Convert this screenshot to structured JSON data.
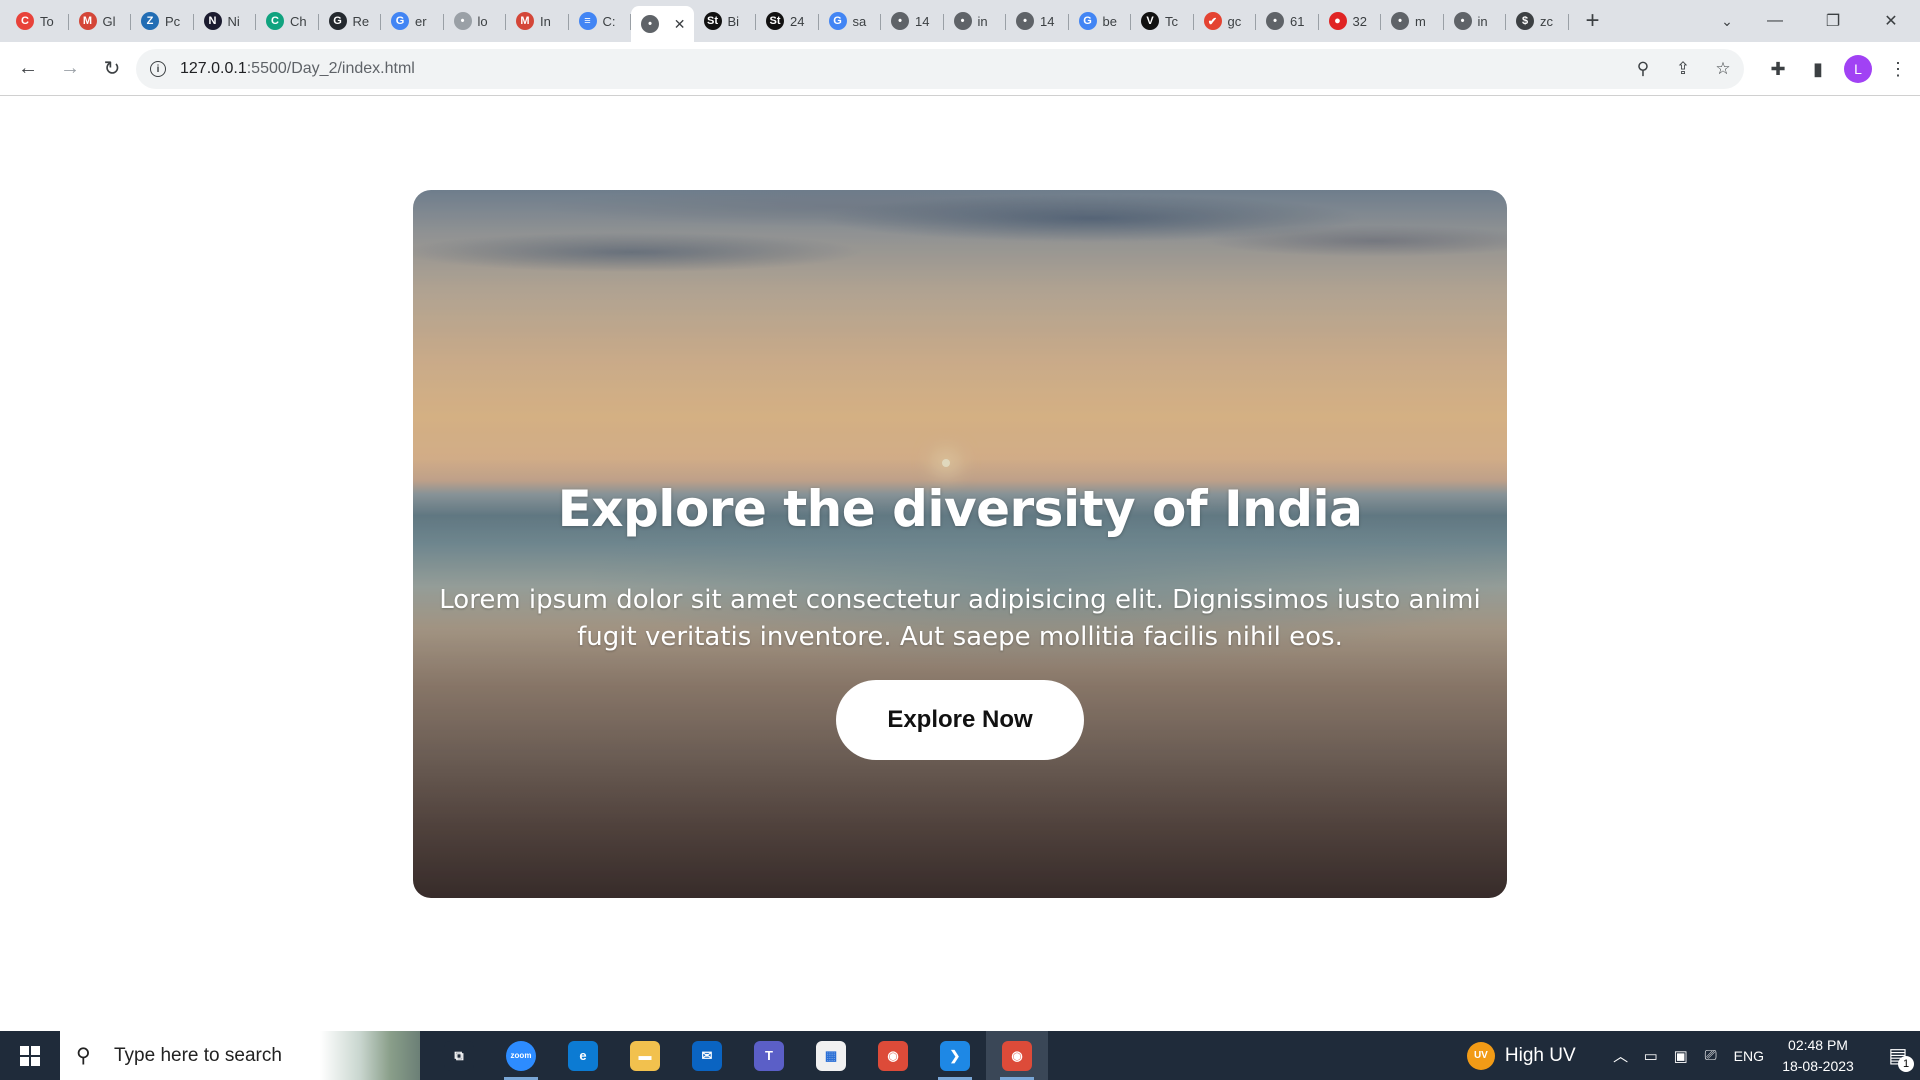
{
  "browser": {
    "tabs": [
      {
        "title": "To",
        "icon": "coursera-icon",
        "color": "#e8423a",
        "glyph": "C"
      },
      {
        "title": "Gl",
        "icon": "gmail-icon",
        "color": "#d44638",
        "glyph": "M"
      },
      {
        "title": "Pc",
        "icon": "zoho-icon",
        "color": "#226db4",
        "glyph": "Z"
      },
      {
        "title": "Ni",
        "icon": "notion-icon",
        "color": "#1b1b2f",
        "glyph": "N"
      },
      {
        "title": "Ch",
        "icon": "chatgpt-icon",
        "color": "#10a37f",
        "glyph": "C"
      },
      {
        "title": "Re",
        "icon": "github-icon",
        "color": "#24292f",
        "glyph": "G"
      },
      {
        "title": "er",
        "icon": "google-icon",
        "color": "#4285f4",
        "glyph": "G"
      },
      {
        "title": "lo",
        "icon": "globe-icon",
        "color": "#9aa0a6",
        "glyph": "•"
      },
      {
        "title": "In",
        "icon": "gmail-icon",
        "color": "#d44638",
        "glyph": "M"
      },
      {
        "title": "C:",
        "icon": "docs-icon",
        "color": "#4285f4",
        "glyph": "≡"
      },
      {
        "title": "",
        "icon": "globe-icon",
        "color": "#5f6368",
        "glyph": "•",
        "active": true
      },
      {
        "title": "Bi",
        "icon": "studocu-icon",
        "color": "#111111",
        "glyph": "St"
      },
      {
        "title": "24",
        "icon": "studocu-icon",
        "color": "#111111",
        "glyph": "St"
      },
      {
        "title": "sa",
        "icon": "google-icon",
        "color": "#4285f4",
        "glyph": "G"
      },
      {
        "title": "14",
        "icon": "globe-icon",
        "color": "#5f6368",
        "glyph": "•"
      },
      {
        "title": "in",
        "icon": "globe-icon",
        "color": "#5f6368",
        "glyph": "•"
      },
      {
        "title": "14",
        "icon": "globe-icon",
        "color": "#5f6368",
        "glyph": "•"
      },
      {
        "title": "be",
        "icon": "google-icon",
        "color": "#4285f4",
        "glyph": "G"
      },
      {
        "title": "Tc",
        "icon": "vercel-icon",
        "color": "#111111",
        "glyph": "V"
      },
      {
        "title": "gc",
        "icon": "todoist-icon",
        "color": "#e44332",
        "glyph": "✔"
      },
      {
        "title": "61",
        "icon": "globe-icon",
        "color": "#5f6368",
        "glyph": "•"
      },
      {
        "title": "32",
        "icon": "red-icon",
        "color": "#e02424",
        "glyph": "●"
      },
      {
        "title": "m",
        "icon": "globe-icon",
        "color": "#5f6368",
        "glyph": "•"
      },
      {
        "title": "in",
        "icon": "globe-icon",
        "color": "#5f6368",
        "glyph": "•"
      },
      {
        "title": "zc",
        "icon": "dollar-icon",
        "color": "#3c4043",
        "glyph": "$"
      }
    ],
    "url_host": "127.0.0.1",
    "url_rest": ":5500/Day_2/index.html",
    "profile_initial": "L"
  },
  "hero": {
    "title": "Explore the diversity of India",
    "text": "Lorem ipsum dolor sit amet consectetur adipisicing elit. Dignissimos iusto animi fugit veritatis inventore. Aut saepe mollitia facilis nihil eos.",
    "button_label": "Explore Now"
  },
  "taskbar": {
    "search_placeholder": "Type here to search",
    "apps": [
      {
        "name": "task-view-icon",
        "color": "#1f2b3a",
        "glyph": "⧉",
        "open": false
      },
      {
        "name": "zoom-icon",
        "color": "#2d8cff",
        "glyph": "zoom",
        "open": true
      },
      {
        "name": "edge-icon",
        "color": "#0c7bd3",
        "glyph": "e",
        "open": false
      },
      {
        "name": "file-explorer-icon",
        "color": "#f2c14e",
        "glyph": "▬",
        "open": false
      },
      {
        "name": "mail-icon",
        "color": "#0a64c2",
        "glyph": "✉",
        "open": false
      },
      {
        "name": "teams-icon",
        "color": "#5b5fc7",
        "glyph": "T",
        "open": false
      },
      {
        "name": "store-icon",
        "color": "#f1f1f1",
        "glyph": "▦",
        "open": false
      },
      {
        "name": "chrome-icon",
        "color": "#dd4b39",
        "glyph": "◉",
        "open": false
      },
      {
        "name": "vscode-icon",
        "color": "#1e88e5",
        "glyph": "❯",
        "open": true
      },
      {
        "name": "chrome-profile-icon",
        "color": "#dd4b39",
        "glyph": "◉",
        "open": true,
        "active": true
      }
    ],
    "weather_badge": "UV",
    "weather_label": "High UV",
    "language": "ENG",
    "time": "02:48 PM",
    "date": "18-08-2023",
    "notification_count": "1"
  }
}
